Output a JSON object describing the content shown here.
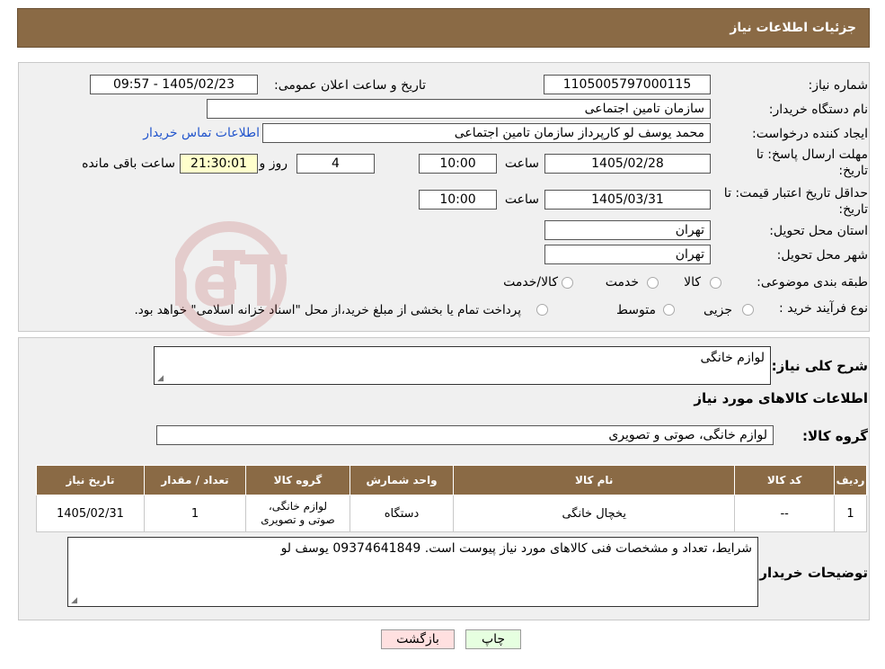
{
  "header": {
    "title": "جزئیات اطلاعات نیاز"
  },
  "form": {
    "need_number": {
      "label": "شماره نیاز:",
      "value": "1105005797000115"
    },
    "announce_datetime": {
      "label": "تاریخ و ساعت اعلان عمومی:",
      "value": "1405/02/23 - 09:57"
    },
    "buyer_org": {
      "label": "نام دستگاه خریدار:",
      "value": "سازمان تامین اجتماعی"
    },
    "requester": {
      "label": "ایجاد کننده درخواست:",
      "value": "محمد یوسف لو کارپرداز سازمان تامین اجتماعی"
    },
    "buyer_contact_link": "اطلاعات تماس خریدار",
    "reply_deadline": {
      "label_line1": "مهلت ارسال پاسخ: تا",
      "label_line2": "تاریخ:",
      "date": "1405/02/28",
      "time_label": "ساعت",
      "time": "10:00",
      "days": "4",
      "days_label": "روز و",
      "remaining_time": "21:30:01",
      "remaining_label": "ساعت باقی مانده"
    },
    "price_validity": {
      "label_line1": "حداقل تاریخ اعتبار قیمت: تا",
      "label_line2": "تاریخ:",
      "date": "1405/03/31",
      "time_label": "ساعت",
      "time": "10:00"
    },
    "delivery_province": {
      "label": "استان محل تحویل:",
      "value": "تهران"
    },
    "delivery_city": {
      "label": "شهر محل تحویل:",
      "value": "تهران"
    },
    "category": {
      "label": "طبقه بندی موضوعی:",
      "options": [
        "کالا",
        "خدمت",
        "کالا/خدمت"
      ]
    },
    "purchase_process": {
      "label": "نوع فرآیند خرید :",
      "options": [
        "جزیی",
        "متوسط"
      ],
      "note": "پرداخت تمام یا بخشی از مبلغ خرید،از محل \"اسناد خزانه اسلامی\" خواهد بود."
    }
  },
  "details": {
    "general_desc_label": "شرح کلی نیاز:",
    "general_desc_value": "لوازم خانگی",
    "items_info_title": "اطلاعات کالاهای مورد نیاز",
    "goods_group_label": "گروه کالا:",
    "goods_group_value": "لوازم خانگی، صوتی و تصویری",
    "table": {
      "headers": [
        "ردیف",
        "کد کالا",
        "نام کالا",
        "واحد شمارش",
        "گروه کالا",
        "تعداد / مقدار",
        "تاریخ نیاز"
      ],
      "rows": [
        [
          "1",
          "--",
          "یخچال خانگی",
          "دستگاه",
          "لوازم خانگی، صوتی و تصویری",
          "1",
          "1405/02/31"
        ]
      ]
    },
    "buyer_notes_label": "توضیحات خریدار:",
    "buyer_notes_value": "شرایط، تعداد و مشخصات فنی کالاهای مورد نیاز پیوست است. 09374641849 یوسف لو"
  },
  "buttons": {
    "print": "چاپ",
    "back": "بازگشت"
  },
  "watermark": {
    "text": "AriaTender.neT"
  },
  "colors": {
    "header_bg": "#8a6a45",
    "panel_bg": "#f0f0f0",
    "link": "#2255cc",
    "print_btn": "#e6ffe0",
    "back_btn": "#ffe0e0",
    "remaining_bg": "#ffffcc"
  }
}
